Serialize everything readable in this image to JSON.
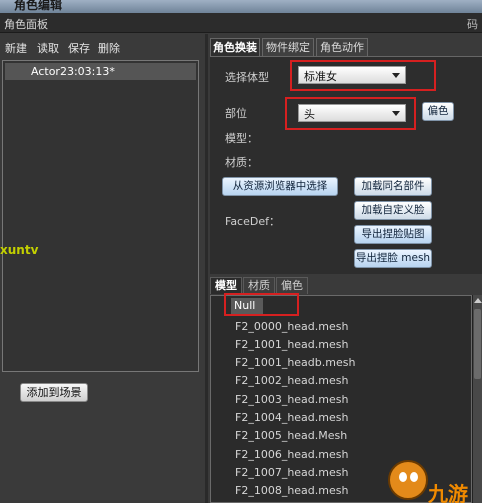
{
  "window": {
    "title": "角色编辑",
    "panel_title": "角色面板",
    "panel_right": "码"
  },
  "left": {
    "menu": [
      "新建",
      "读取",
      "保存",
      "删除"
    ],
    "actors": [
      "Actor23:03:13*"
    ],
    "add_to_scene_label": "添加到场景"
  },
  "tabs": [
    "角色换装",
    "物件绑定",
    "角色动作"
  ],
  "outfit": {
    "body_type_label": "选择体型",
    "body_type_value": "标准女",
    "part_label": "部位",
    "part_value": "头",
    "color_button": "偏色",
    "model_label": "模型：",
    "material_label": "材质：",
    "select_from_browser": "从资源浏览器中选择",
    "load_same_name": "加载同名部件",
    "load_custom_face": "加载自定义脸",
    "facedef_label": "FaceDef：",
    "export_face_map": "导出捏脸贴图",
    "export_face_mesh": "导出捏脸 mesh"
  },
  "bottom_tabs": [
    "模型",
    "材质",
    "偏色"
  ],
  "mesh_list": {
    "selected": "Null",
    "items": [
      "F2_0000_head.mesh",
      "F2_1001_head.mesh",
      "F2_1001_headb.mesh",
      "F2_1002_head.mesh",
      "F2_1003_head.mesh",
      "F2_1004_head.mesh",
      "F2_1005_head.Mesh",
      "F2_1006_head.mesh",
      "F2_1007_head.mesh",
      "F2_1008_head.mesh"
    ]
  },
  "watermarks": {
    "left": "xuntv",
    "brand": "九游"
  },
  "colors": {
    "highlight_box": "#d62020",
    "panel_bg": "#2d2d2d",
    "watermark_orange": "#f08a00"
  }
}
